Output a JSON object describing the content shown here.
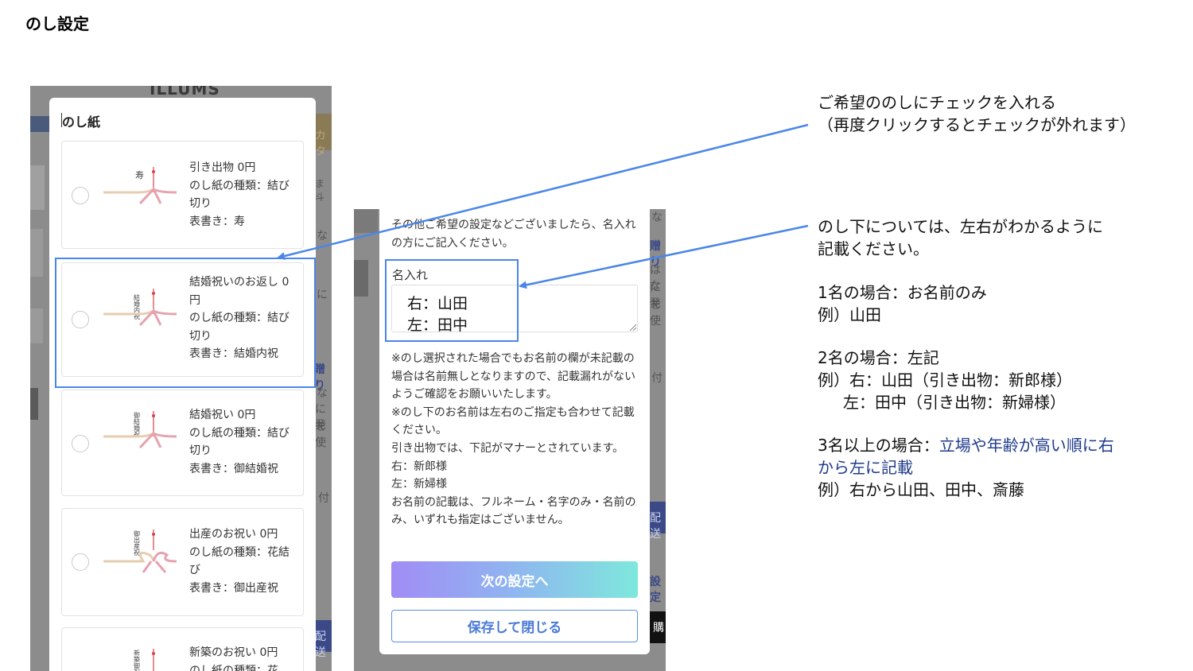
{
  "slide": {
    "title": "のし設定"
  },
  "left": {
    "bg_logo": "ILLUMS",
    "bg_fragments": [
      "カタ",
      "ま斗",
      "な",
      "に",
      "贈り",
      "な",
      "に発",
      "を使",
      "付",
      "配送"
    ],
    "modal_title": "のし紙",
    "cards": [
      {
        "lines": [
          "引き出物 0円",
          "のし紙の種類：結び切り",
          "表書き：寿"
        ],
        "noshi_text": "寿",
        "knot": "結び切り"
      },
      {
        "lines": [
          "結婚祝いのお返し 0円",
          "のし紙の種類：結び切り",
          "表書き：結婚内祝"
        ],
        "noshi_text": "結婚内祝",
        "knot": "結び切り"
      },
      {
        "lines": [
          "結婚祝い 0円",
          "のし紙の種類：結び切り",
          "表書き：御結婚祝"
        ],
        "noshi_text": "御結婚祝",
        "knot": "結び切り"
      },
      {
        "lines": [
          "出産のお祝い 0円",
          "のし紙の種類：花結び",
          "表書き：御出産祝"
        ],
        "noshi_text": "御出産祝",
        "knot": "花結び"
      },
      {
        "lines": [
          "新築のお祝い 0円",
          "のし紙の種類：花"
        ],
        "noshi_text": "新築御祝",
        "knot": "花結び"
      }
    ]
  },
  "middle": {
    "intro": "その他ご希望の設定などございましたら、名入れの方にご記入ください。",
    "name_label": "名入れ",
    "name_lines": [
      "右：山田",
      "左：田中"
    ],
    "bg_fragments": [
      "な",
      "贈り",
      "はな",
      "に発",
      "を使",
      "付",
      "配送",
      "設定",
      "購"
    ],
    "notes": [
      "※のし選択された場合でもお名前の欄が未記載の場合は名前無しとなりますので、記載漏れがないようご確認をお願いいたします。",
      "※のし下のお名前は左右のご指定も合わせて記載ください。",
      "引き出物では、下記がマナーとされています。",
      "右：新郎様",
      "左：新婦様",
      "お名前の記載は、フルネーム・名字のみ・名前のみ、いずれも指定はございません。"
    ],
    "next_button": "次の設定へ",
    "save_button": "保存して閉じる"
  },
  "annotations": {
    "block1": [
      "ご希望ののしにチェックを入れる",
      "（再度クリックするとチェックが外れます）"
    ],
    "block2": [
      "のし下については、左右がわかるように",
      "記載ください。"
    ],
    "case1": [
      "1名の場合：お名前のみ",
      "例）山田"
    ],
    "case2": [
      "2名の場合：左記",
      "例）右：山田（引き出物：新郎様）",
      "左：田中（引き出物：新婦様）"
    ],
    "case3_prefix": "3名以上の場合：",
    "case3_emph1": "立場や年齢が高い順に右",
    "case3_emph2": "から左に記載",
    "case3_example": "例）右から山田、田中、斎藤"
  },
  "colors": {
    "highlight": "#4a86e8",
    "gradient_start": "#a18cf5",
    "gradient_end": "#7ee8dc",
    "emphasis": "#1e3a8a"
  }
}
